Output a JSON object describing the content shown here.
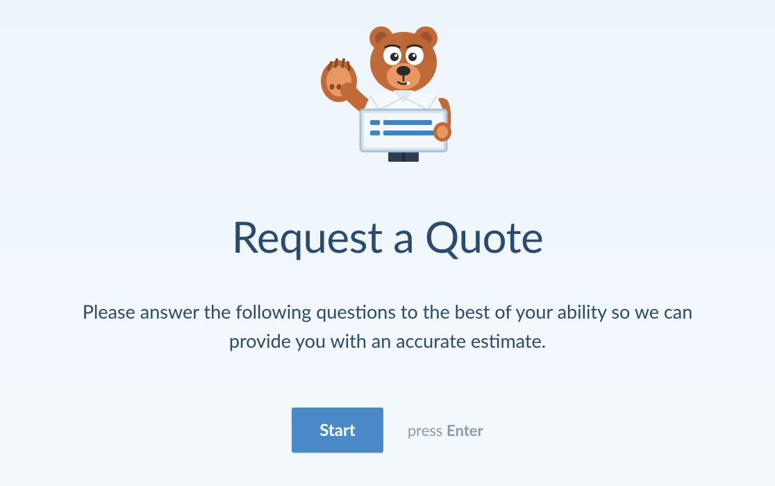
{
  "heading": "Request a Quote",
  "description": "Please answer the following questions to the best of your ability so we can provide you with an accurate estimate.",
  "start_button_label": "Start",
  "hint_prefix": "press ",
  "hint_key": "Enter",
  "colors": {
    "primary_button": "#4a89c7",
    "text_primary": "#2a4a6e",
    "text_muted": "#8a99ac",
    "background": "#edf5fc"
  },
  "mascot": {
    "name": "bear-mascot",
    "description": "Brown bear waving holding a form clipboard"
  }
}
